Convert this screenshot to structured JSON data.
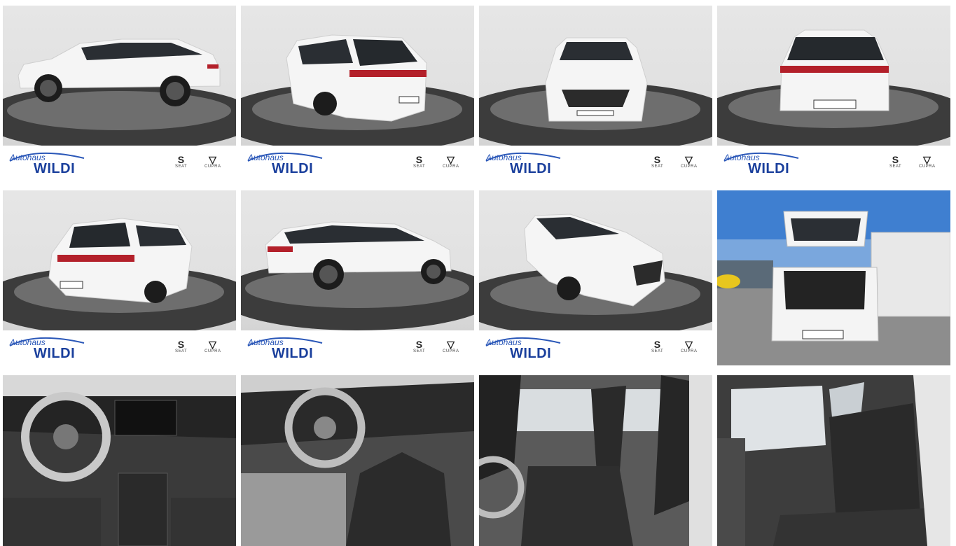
{
  "dealer": {
    "script_text": "Autohaus",
    "name_text": "WILDI",
    "brand_seat": "SEAT",
    "brand_cupra": "CUPRA"
  },
  "gallery": {
    "photos": [
      {
        "view": "side-left"
      },
      {
        "view": "rear-left-three-quarter"
      },
      {
        "view": "front"
      },
      {
        "view": "rear"
      },
      {
        "view": "rear-right-three-quarter"
      },
      {
        "view": "side-right"
      },
      {
        "view": "front-left-three-quarter"
      },
      {
        "view": "open-trunk-outdoor"
      },
      {
        "view": "dashboard"
      },
      {
        "view": "driver-seat-steering"
      },
      {
        "view": "front-seats"
      },
      {
        "view": "rear-seats"
      }
    ]
  },
  "colors": {
    "car_body": "#f4f4f4",
    "floor": "#4a4a4a",
    "dealer_blue": "#1a3f9c",
    "studio_bg": "#e4e4e4"
  }
}
